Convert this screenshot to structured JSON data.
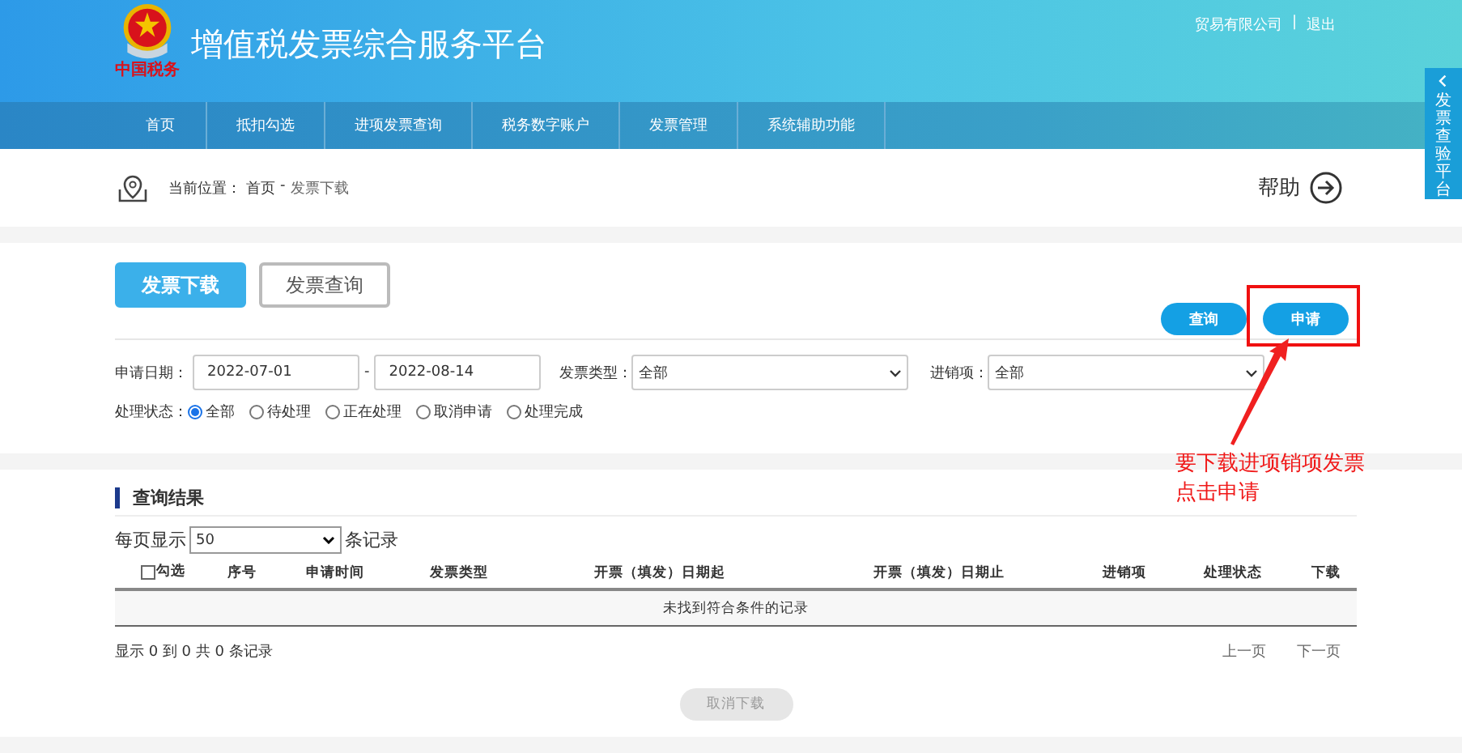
{
  "header": {
    "logo_text": "中国税务",
    "title": "增值税发票综合服务平台",
    "user": "贸易有限公司",
    "separator": "|",
    "logout": "退出"
  },
  "nav": [
    {
      "label": "首页"
    },
    {
      "label": "抵扣勾选"
    },
    {
      "label": "进项发票查询"
    },
    {
      "label": "税务数字账户"
    },
    {
      "label": "发票管理"
    },
    {
      "label": "系统辅助功能"
    }
  ],
  "breadcrumb": {
    "prefix": "当前位置：",
    "home": "首页",
    "separator": "-",
    "current": "发票下载",
    "help": "帮助"
  },
  "tabs": [
    {
      "label": "发票下载",
      "selected": true
    },
    {
      "label": "发票查询",
      "selected": false
    }
  ],
  "actions": [
    "查询",
    "申请"
  ],
  "filters": {
    "date_label": "申请日期：",
    "date_from": "2022-07-01",
    "date_dash": "-",
    "date_to": "2022-08-14",
    "type_label": "发票类型：",
    "type_value": "全部",
    "direction_label": "进销项：",
    "direction_value": "全部"
  },
  "status": {
    "label": "处理状态：",
    "options": [
      {
        "label": "全部",
        "selected": true
      },
      {
        "label": "待处理",
        "selected": false
      },
      {
        "label": "正在处理",
        "selected": false
      },
      {
        "label": "取消申请",
        "selected": false
      },
      {
        "label": "处理完成",
        "selected": false
      }
    ]
  },
  "results": {
    "title": "查询结果",
    "page_size_label": "每页显示",
    "page_size": "50",
    "page_size_suffix": "条记录",
    "select_all": {
      "label": "勾选",
      "checked": false
    },
    "columns": [
      "序号",
      "申请时间",
      "发票类型",
      "开票（填发）日期起",
      "开票（填发）日期止",
      "进销项",
      "处理状态",
      "下载"
    ],
    "empty": "未找到符合条件的记录",
    "summary": "显示 0 到 0 共 0 条记录",
    "prev": "上一页",
    "next": "下一页",
    "cancel": {
      "label": "取消下载",
      "disabled": true
    }
  },
  "side_tab": {
    "label": "发票查验平台"
  },
  "note": [
    "要下载进项销项发票",
    "点击申请"
  ]
}
